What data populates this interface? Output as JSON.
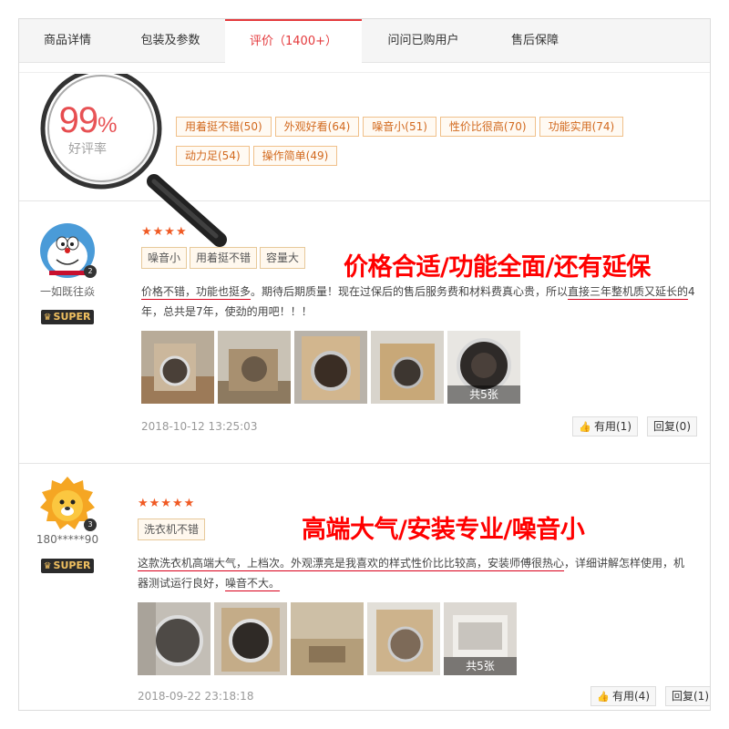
{
  "tabs": [
    {
      "label": "商品详情"
    },
    {
      "label": "包装及参数"
    },
    {
      "label": "评价（1400+）"
    },
    {
      "label": "问问已购用户"
    },
    {
      "label": "售后保障"
    }
  ],
  "summary": {
    "rate_value": "99",
    "rate_pct": "%",
    "rate_label": "好评率",
    "tags": [
      "用着挺不错(50)",
      "外观好看(64)",
      "噪音小(51)",
      "性价比很高(70)",
      "功能实用(74)",
      "动力足(54)",
      "操作简单(49)"
    ]
  },
  "reviews": [
    {
      "user": "一如既往焱",
      "level": "2",
      "badge": "SUPER",
      "stars": "★★★★",
      "tags": [
        "噪音小",
        "用着挺不错",
        "容量大"
      ],
      "headline": "价格合适/功能全面/还有延保",
      "content_a": "价格不错，功能也挺多",
      "content_b": "。期待后期质量！现在过保后的售后服务费和材料费真心贵，所以",
      "content_c": "直接三年整机质又延长的",
      "content_d": "4年，总共是7年，使劲的用吧！！！",
      "photo_count": "共5张",
      "date": "2018-10-12 13:25:03",
      "useful": "有用(1)",
      "reply": "回复(0)"
    },
    {
      "user": "180*****90",
      "level": "3",
      "badge": "SUPER",
      "stars": "★★★★★",
      "tags": [
        "洗衣机不错"
      ],
      "headline": "高端大气/安装专业/噪音小",
      "content_a": "这款洗衣机高端大气，上档次。外观漂亮是我喜欢的样式性价比比较高，安装师傅很热心",
      "content_b": "，详细讲解怎样使用，机器测试运行良好，",
      "content_c": "噪音不大。",
      "photo_count": "共5张",
      "date": "2018-09-22 23:18:18",
      "useful": "有用(4)",
      "reply": "回复(1)"
    }
  ],
  "colors": {
    "accent": "#e4393c",
    "headline": "#ff0000",
    "tag_border": "#f0c08a",
    "tag_text": "#d2691e"
  }
}
